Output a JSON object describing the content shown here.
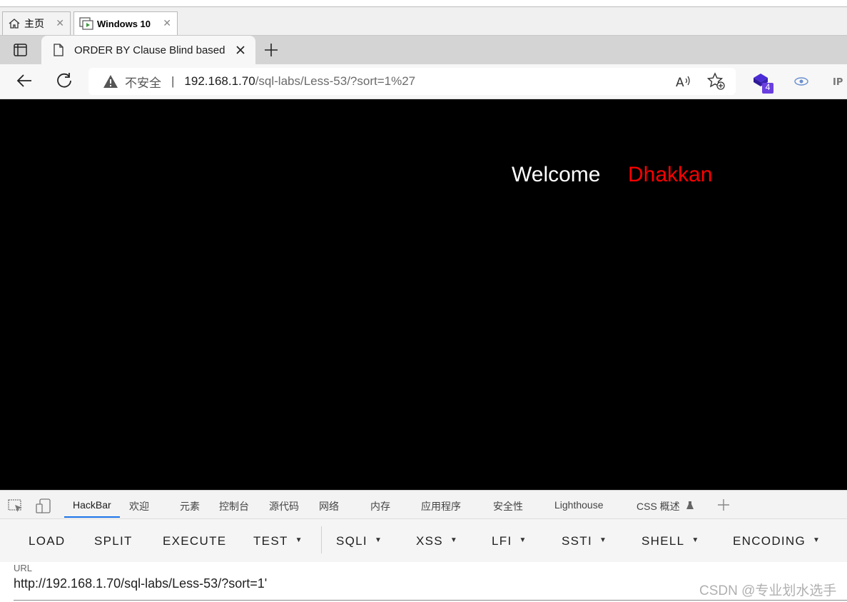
{
  "vm_tabs": [
    {
      "label": "主页",
      "icon": "home-icon"
    },
    {
      "label": "Windows 10",
      "icon": "vm-screen-icon"
    }
  ],
  "browser": {
    "tab_title": "ORDER BY Clause Blind based",
    "security_label": "不安全",
    "url_host": "192.168.1.70",
    "url_path": "/sql-labs/Less-53/?sort=1%27",
    "extension_badge": "4"
  },
  "page": {
    "welcome": "Welcome",
    "name": "Dhakkan"
  },
  "devtools": {
    "tabs": [
      "HackBar",
      "欢迎",
      "元素",
      "控制台",
      "源代码",
      "网络",
      "内存",
      "应用程序",
      "安全性",
      "Lighthouse",
      "CSS 概述"
    ],
    "active_tab": "HackBar"
  },
  "hackbar": {
    "buttons": [
      "LOAD",
      "SPLIT",
      "EXECUTE",
      "TEST",
      "SQLI",
      "XSS",
      "LFI",
      "SSTI",
      "SHELL",
      "ENCODING"
    ],
    "url_label": "URL",
    "url_value": "http://192.168.1.70/sql-labs/Less-53/?sort=1'"
  },
  "watermark": "CSDN @专业划水选手",
  "colors": {
    "page_bg": "#000000",
    "welcome_text": "#ffffff",
    "name_text": "#ff0000",
    "active_tab_underline": "#1a73e8"
  }
}
